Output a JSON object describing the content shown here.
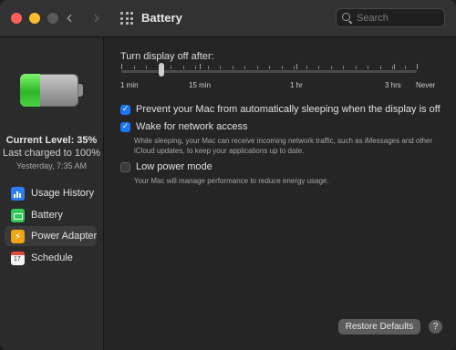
{
  "window": {
    "title": "Battery",
    "search": {
      "placeholder": "Search"
    }
  },
  "sidebar": {
    "battery_level_percent": 35,
    "current_level": "Current Level: 35%",
    "last_charged": "Last charged to 100%",
    "charged_time": "Yesterday, 7:35 AM",
    "items": [
      {
        "label": "Usage History",
        "icon": "bar-chart-icon",
        "selected": false
      },
      {
        "label": "Battery",
        "icon": "battery-icon",
        "selected": false
      },
      {
        "label": "Power Adapter",
        "icon": "power-bolt-icon",
        "selected": true
      },
      {
        "label": "Schedule",
        "icon": "calendar-icon",
        "selected": false
      }
    ]
  },
  "main": {
    "display_off_label": "Turn display off after:",
    "slider": {
      "value": "3 min",
      "labels": [
        "1 min",
        "15 min",
        "1 hr",
        "3 hrs",
        "Never"
      ]
    },
    "options": [
      {
        "label": "Prevent your Mac from automatically sleeping when the display is off",
        "checked": true
      },
      {
        "label": "Wake for network access",
        "checked": true,
        "description": "While sleeping, your Mac can receive incoming network traffic, such as iMessages and other iCloud updates, to keep your applications up to date."
      },
      {
        "label": "Low power mode",
        "checked": false,
        "description": "Your Mac will manage performance to reduce energy usage."
      }
    ],
    "restore_label": "Restore Defaults",
    "help_label": "?"
  },
  "colors": {
    "accent": "#1a76f4",
    "battery_green": "#34c759"
  }
}
